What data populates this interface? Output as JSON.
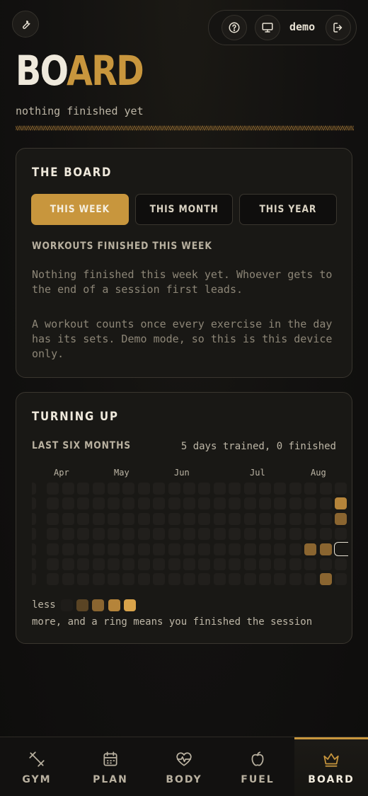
{
  "header": {
    "title_part_plain": "BO",
    "title_part_accent": "ARD",
    "subtitle": "nothing finished yet",
    "user_name": "demo",
    "icons": {
      "tools": "wrench-icon",
      "help": "help-circle-icon",
      "device": "monitor-icon",
      "logout": "logout-icon"
    }
  },
  "board_card": {
    "title": "THE BOARD",
    "tabs": [
      {
        "label": "THIS WEEK",
        "active": true
      },
      {
        "label": "THIS MONTH",
        "active": false
      },
      {
        "label": "THIS YEAR",
        "active": false
      }
    ],
    "section_label": "WORKOUTS FINISHED THIS WEEK",
    "empty_message": "Nothing finished this week yet. Whoever gets to the end of a session first leads.",
    "note": "A workout counts once every exercise in the day has its sets. Demo mode, so this is this device only."
  },
  "turning_card": {
    "title": "TURNING UP",
    "range_label": "LAST SIX MONTHS",
    "summary": "5 days trained, 0 finished",
    "months": [
      "Apr",
      "May",
      "Jun",
      "Jul",
      "Aug"
    ],
    "legend_less": "less",
    "legend_more": "more, and a ring means you finished the session",
    "heatmap": {
      "rows": 7,
      "columns": 21,
      "active_cells": [
        {
          "column": 20,
          "row": 1,
          "level": 3
        },
        {
          "column": 20,
          "row": 2,
          "level": 2
        },
        {
          "column": 18,
          "row": 4,
          "level": 2
        },
        {
          "column": 19,
          "row": 4,
          "level": 2
        },
        {
          "column": 20,
          "row": 4,
          "level": 0,
          "ring": true
        },
        {
          "column": 19,
          "row": 6,
          "level": 2
        }
      ]
    },
    "colors": {
      "empty": "#211f1c",
      "levels": [
        "#1e1c19",
        "#5a4424",
        "#8a6530",
        "#b5843a",
        "#d9a34a"
      ],
      "ring": "#e8e2d4"
    }
  },
  "bottom_nav": [
    {
      "label": "GYM",
      "icon": "dumbbell-icon",
      "active": false
    },
    {
      "label": "PLAN",
      "icon": "calendar-icon",
      "active": false
    },
    {
      "label": "BODY",
      "icon": "heart-pulse-icon",
      "active": false
    },
    {
      "label": "FUEL",
      "icon": "apple-icon",
      "active": false
    },
    {
      "label": "BOARD",
      "icon": "crown-icon",
      "active": true
    }
  ],
  "accent_color": "#c8963d"
}
